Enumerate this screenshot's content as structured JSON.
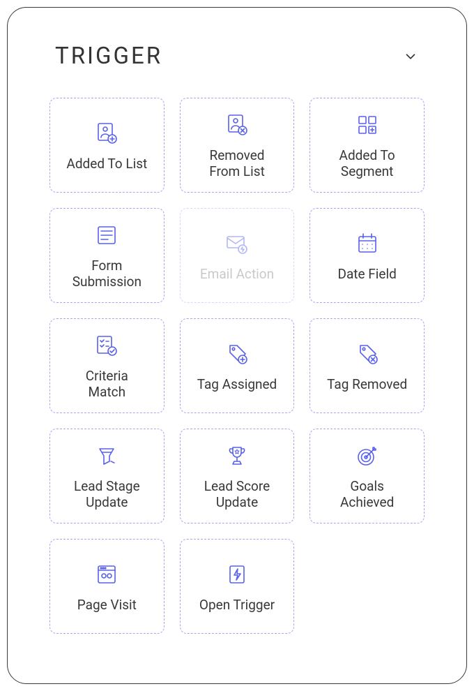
{
  "panel": {
    "title": "TRIGGER"
  },
  "triggers": [
    {
      "label": "Added To List",
      "icon": "user-add",
      "disabled": false
    },
    {
      "label": "Removed\nFrom List",
      "icon": "user-remove",
      "disabled": false
    },
    {
      "label": "Added To\nSegment",
      "icon": "segment-add",
      "disabled": false
    },
    {
      "label": "Form\nSubmission",
      "icon": "form",
      "disabled": false
    },
    {
      "label": "Email Action",
      "icon": "email-action",
      "disabled": true
    },
    {
      "label": "Date Field",
      "icon": "calendar",
      "disabled": false
    },
    {
      "label": "Criteria\nMatch",
      "icon": "criteria",
      "disabled": false
    },
    {
      "label": "Tag Assigned",
      "icon": "tag-add",
      "disabled": false
    },
    {
      "label": "Tag Removed",
      "icon": "tag-remove",
      "disabled": false
    },
    {
      "label": "Lead Stage\nUpdate",
      "icon": "funnel",
      "disabled": false
    },
    {
      "label": "Lead Score\nUpdate",
      "icon": "trophy",
      "disabled": false
    },
    {
      "label": "Goals\nAchieved",
      "icon": "target",
      "disabled": false
    },
    {
      "label": "Page Visit",
      "icon": "page",
      "disabled": false
    },
    {
      "label": "Open Trigger",
      "icon": "bolt",
      "disabled": false
    }
  ]
}
